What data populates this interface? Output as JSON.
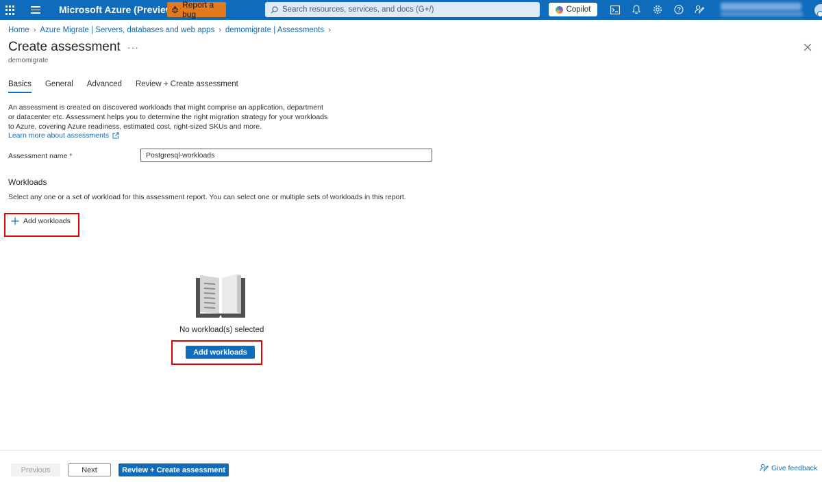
{
  "topbar": {
    "brand": "Microsoft Azure (Preview)",
    "report_bug_label": "Report a bug",
    "search_placeholder": "Search resources, services, and docs (G+/)",
    "copilot_label": "Copilot",
    "accent_color": "#0f6cbd",
    "icons": [
      "waffle-icon",
      "hamburger-icon",
      "bug-icon",
      "search-icon",
      "cloud-shell-icon",
      "notifications-icon",
      "settings-icon",
      "help-icon",
      "feedback-icon"
    ]
  },
  "breadcrumb": [
    "Home",
    "Azure Migrate | Servers, databases and web apps",
    "demomigrate | Assessments"
  ],
  "page": {
    "title": "Create assessment",
    "more_label": "···",
    "subtitle": "demomigrate"
  },
  "tabs": [
    {
      "label": "Basics",
      "active": true
    },
    {
      "label": "General",
      "active": false
    },
    {
      "label": "Advanced",
      "active": false
    },
    {
      "label": "Review + Create assessment",
      "active": false
    }
  ],
  "intro": {
    "description": "An assessment is created on discovered workloads that might comprise an application, department or datacenter etc. Assessment helps you to determine the right migration strategy for your workloads to Azure, covering Azure readiness, estimated cost, right-sized SKUs and more.",
    "learn_more": "Learn more about assessments"
  },
  "form": {
    "assessment_name_label": "Assessment name",
    "required_marker": "*",
    "assessment_name_value": "Postgresql-workloads"
  },
  "workloads": {
    "title": "Workloads",
    "description": "Select any one or a set of workload for this assessment report. You can select one or multiple sets of workloads in this report.",
    "add_link_label": "Add workloads",
    "empty_text": "No workload(s) selected",
    "add_button_label": "Add workloads"
  },
  "footer": {
    "previous_label": "Previous",
    "next_label": "Next",
    "review_label": "Review + Create assessment",
    "feedback_label": "Give feedback"
  }
}
